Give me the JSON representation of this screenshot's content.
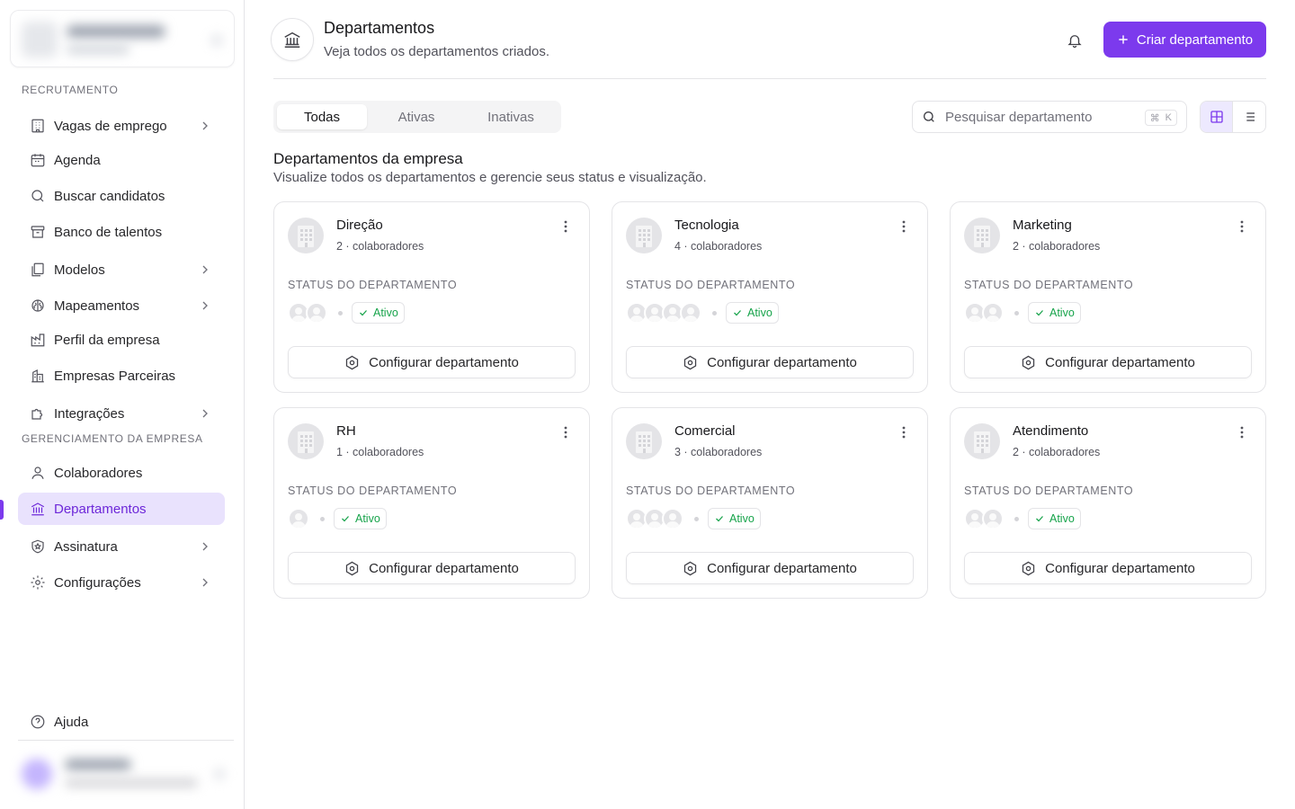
{
  "sidebar": {
    "sections": {
      "recruitment": "RECRUTAMENTO",
      "company": "GERENCIAMENTO DA EMPRESA"
    },
    "items": [
      {
        "label": "Vagas de emprego"
      },
      {
        "label": "Agenda"
      },
      {
        "label": "Buscar candidatos"
      },
      {
        "label": "Banco de talentos"
      },
      {
        "label": "Modelos"
      },
      {
        "label": "Mapeamentos"
      },
      {
        "label": "Perfil da empresa"
      },
      {
        "label": "Empresas Parceiras"
      },
      {
        "label": "Integrações"
      },
      {
        "label": "Colaboradores"
      },
      {
        "label": "Departamentos"
      },
      {
        "label": "Assinatura"
      },
      {
        "label": "Configurações"
      },
      {
        "label": "Ajuda"
      }
    ],
    "active_item": "Departamentos"
  },
  "header": {
    "title": "Departamentos",
    "subtitle": "Veja todos os departamentos criados.",
    "create_button": "Criar departamento"
  },
  "tabs": [
    "Todas",
    "Ativas",
    "Inativas"
  ],
  "selected_tab": "Todas",
  "search": {
    "placeholder": "Pesquisar departamento",
    "shortcut_mod": "⌘",
    "shortcut_key": "K"
  },
  "view_mode": "grid",
  "section": {
    "title": "Departamentos da empresa",
    "subtitle": "Visualize todos os departamentos e gerencie seus status e visualização."
  },
  "card_labels": {
    "status_label": "STATUS DO DEPARTAMENTO",
    "configure_button": "Configurar departamento"
  },
  "departments": [
    {
      "name": "Direção",
      "members": "2 · colaboradores",
      "status": "Ativo"
    },
    {
      "name": "Tecnologia",
      "members": "4 · colaboradores",
      "status": "Ativo"
    },
    {
      "name": "Marketing",
      "members": "2 · colaboradores",
      "status": "Ativo"
    },
    {
      "name": "RH",
      "members": "1 · colaboradores",
      "status": "Ativo"
    },
    {
      "name": "Comercial",
      "members": "3 · colaboradores",
      "status": "Ativo"
    },
    {
      "name": "Atendimento",
      "members": "2 · colaboradores",
      "status": "Ativo"
    }
  ],
  "colors": {
    "accent": "#7c3aed",
    "active_bg": "#e9e2fd",
    "status_green": "#16a34a"
  }
}
